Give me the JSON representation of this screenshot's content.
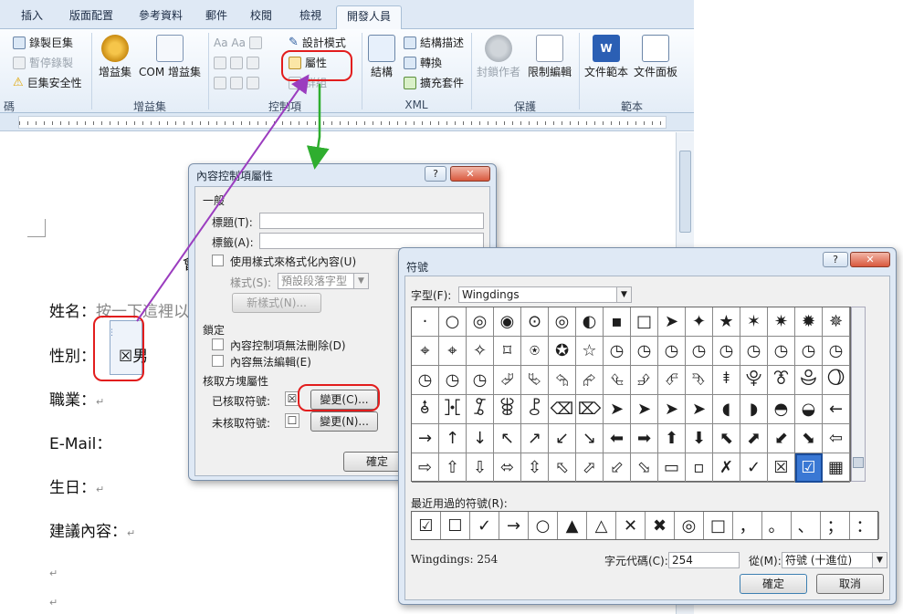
{
  "ribbon": {
    "tabs": [
      "插入",
      "版面配置",
      "參考資料",
      "郵件",
      "校閱",
      "檢視",
      "開發人員"
    ],
    "active_tab": "開發人員",
    "code_group": {
      "record_macro": "錄製巨集",
      "pause_recording": "暫停錄製",
      "macro_security": "巨集安全性",
      "label": "碼"
    },
    "addins_group": {
      "addins": "增益集",
      "com_addins": "COM 增益集",
      "label": "增益集"
    },
    "controls_group": {
      "design_mode": "設計模式",
      "properties": "屬性",
      "group": "群組",
      "label": "控制項"
    },
    "xml_group": {
      "structure": "結構",
      "schema": "結構描述",
      "transform": "轉換",
      "expansion_packs": "擴充套件",
      "label": "XML"
    },
    "protect_group": {
      "block_authors": "封鎖作者",
      "restrict_editing": "限制編輯",
      "label": "保護"
    },
    "templates_group": {
      "document_template": "文件範本",
      "document_panel": "文件面板",
      "label": "範本"
    }
  },
  "document": {
    "name_label": "姓名：",
    "name_placeholder": "按一下這裡以",
    "gender_label": "性別：",
    "gender_checkbox": "☒",
    "gender_value": "男",
    "job_label": "職業：",
    "email_label": "E-Mail：",
    "birthday_label": "生日：",
    "suggestion_label": "建議內容：",
    "paragraph_mark": "↵",
    "partial_char": "會"
  },
  "content_control_dialog": {
    "title": "內容控制項屬性",
    "help": "?",
    "close": "✕",
    "general_section": "一般",
    "title_label": "標題(T):",
    "title_value": "",
    "tag_label": "標籤(A):",
    "tag_value": "",
    "use_style_label": "使用樣式來格式化內容(U)",
    "style_label": "樣式(S):",
    "style_value": "預設段落字型",
    "new_style_button": "新樣式(N)...",
    "locking_section": "鎖定",
    "cannot_delete": "內容控制項無法刪除(D)",
    "cannot_edit": "內容無法編輯(E)",
    "checkbox_props_section": "核取方塊屬性",
    "checked_symbol_label": "已核取符號:",
    "checked_symbol": "☒",
    "change_checked_button": "變更(C)...",
    "unchecked_symbol_label": "未核取符號:",
    "unchecked_symbol": "☐",
    "change_unchecked_button": "變更(N)...",
    "ok_button": "確定"
  },
  "symbol_dialog": {
    "title": "符號",
    "help": "?",
    "close": "✕",
    "font_label": "字型(F):",
    "font_value": "Wingdings",
    "symbols": [
      "·",
      "○",
      "◎",
      "◉",
      "⊙",
      "◎",
      "◐",
      "▪",
      "□",
      "➤",
      "✦",
      "★",
      "✶",
      "✷",
      "✹",
      "✵",
      "⌖",
      "⌖",
      "✧",
      "⌑",
      "⍟",
      "✪",
      "☆",
      "◷",
      "◷",
      "◷",
      "◷",
      "◷",
      "◷",
      "◷",
      "◷",
      "◷",
      "◷",
      "◷",
      "◷",
      "⮰",
      "⮱",
      "⮲",
      "⮳",
      "⮴",
      "⮵",
      "⮶",
      "⮷",
      "⯒",
      "⯓",
      "⯔",
      "⯕",
      "⯖",
      "⯗",
      "⯘",
      "⯙",
      "⯚",
      "⯛",
      "⌫",
      "⌦",
      "➤",
      "➤",
      "➤",
      "➤",
      "◖",
      "◗",
      "◓",
      "◒",
      "←",
      "→",
      "↑",
      "↓",
      "↖",
      "↗",
      "↙",
      "↘",
      "⬅",
      "➡",
      "⬆",
      "⬇",
      "⬉",
      "⬈",
      "⬋",
      "⬊",
      "⇦",
      "⇨",
      "⇧",
      "⇩",
      "⬄",
      "⇳",
      "⬁",
      "⬀",
      "⬃",
      "⬂",
      "▭",
      "▫",
      "✗",
      "✓",
      "☒",
      "☑",
      "▦"
    ],
    "selected_symbol": "☑",
    "recent_label": "最近用過的符號(R):",
    "recent_symbols": [
      "☑",
      "☐",
      "✓",
      "→",
      "○",
      "▲",
      "△",
      "✕",
      "✖",
      "◎",
      "□",
      "，",
      "。",
      "、",
      "；",
      "："
    ],
    "char_name": "Wingdings: 254",
    "char_code_label": "字元代碼(C):",
    "char_code": "254",
    "from_label": "從(M):",
    "from_value": "符號 (十進位)",
    "ok_button": "確定",
    "cancel_button": "取消"
  }
}
